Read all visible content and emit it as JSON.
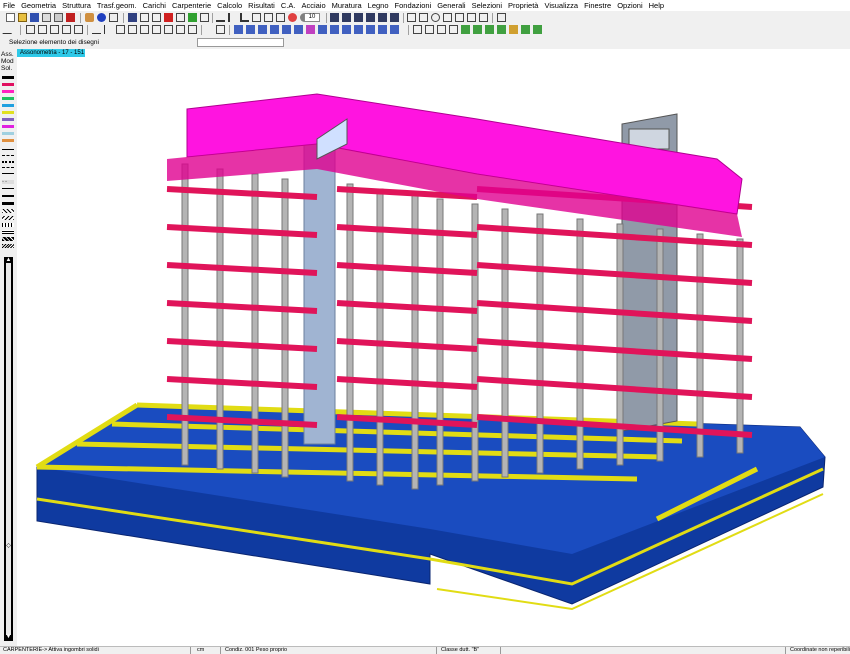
{
  "menu": [
    "File",
    "Geometria",
    "Struttura",
    "Trasf.geom.",
    "Carichi",
    "Carpenterie",
    "Calcolo",
    "Risultati",
    "C.A.",
    "Acciaio",
    "Muratura",
    "Legno",
    "Fondazioni",
    "Generali",
    "Selezioni",
    "Proprietà",
    "Visualizza",
    "Finestre",
    "Opzioni",
    "Help"
  ],
  "toolbar": {
    "zoom_value": "10"
  },
  "selection_bar": {
    "text": "Selezione elemento dei disegni",
    "input_value": ""
  },
  "left_panel": {
    "labels": [
      "Ass.",
      "Mod",
      "Sol."
    ]
  },
  "view_tab": {
    "label": "Assonometria - 17 - 151"
  },
  "status": {
    "command": "CARPENTERIE-> Attiva ingombri solidi",
    "unit": "cm",
    "condition": "Condiz. 001 Peso proprio",
    "duct_class": "Classe dutt. \"B\"",
    "coords": "Coordinate non reperibili"
  },
  "colors": {
    "slab": "#ff14e0",
    "beam": "#e0145a",
    "column": "#b4b4b4",
    "foundation": "#0f3aa0",
    "foundation_beam": "#e1dc14",
    "core": "#a0b4d2"
  }
}
